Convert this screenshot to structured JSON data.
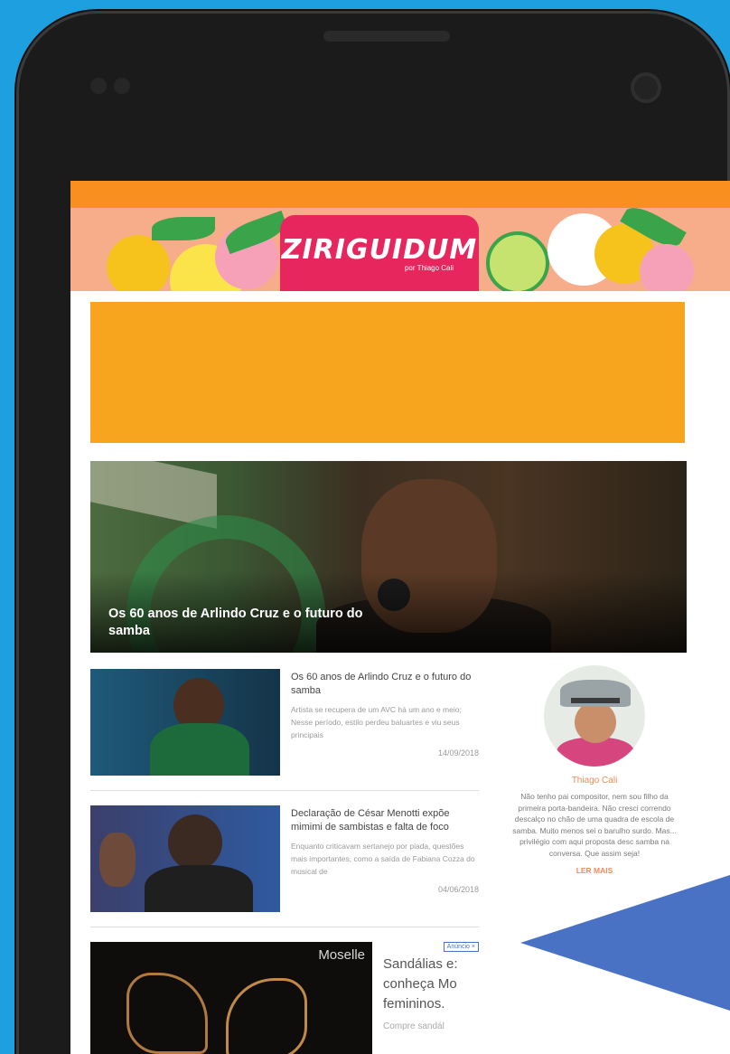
{
  "site": {
    "logo_text": "ZIRIGUIDUM",
    "logo_sub": "por Thiago Cali"
  },
  "hero": {
    "title": "Os 60 anos de Arlindo Cruz e o futuro do samba"
  },
  "articles": [
    {
      "title": "Os 60 anos de Arlindo Cruz e o futuro do samba",
      "desc": "Artista se recupera de um AVC há um ano e meio; Nesse período, estilo perdeu baluartes e viu seus principais",
      "date": "14/09/2018"
    },
    {
      "title": "Declaração de César Menotti expõe mimimi de sambistas e falta de foco",
      "desc": "Enquanto criticavam sertanejo por piada, questões mais importantes, como a saída de Fabiana Cozza do musical de",
      "date": "04/06/2018"
    }
  ],
  "ad": {
    "brand": "Moselle",
    "badge": "Anúncio ×",
    "title_lines": [
      "Sandálias e:",
      "conheça Mo",
      "femininos."
    ],
    "desc": "Compre sandál"
  },
  "author": {
    "name": "Thiago Cali",
    "bio": "Não tenho pai compositor, nem sou filho da primeira porta-bandeira. Não cresci correndo descalço no chão de uma quadra de escola de samba. Muito menos sei o barulho surdo. Mas... privilégio com aqui proposta desc samba na conversa. Que assim seja!",
    "read_more": "LER MAIS"
  },
  "colors": {
    "page_bg": "#1e9fe0",
    "header_orange": "#f98f1f",
    "ad_orange": "#f7a41e",
    "accent": "#f28a5a",
    "overlay": "#4a72c4"
  }
}
